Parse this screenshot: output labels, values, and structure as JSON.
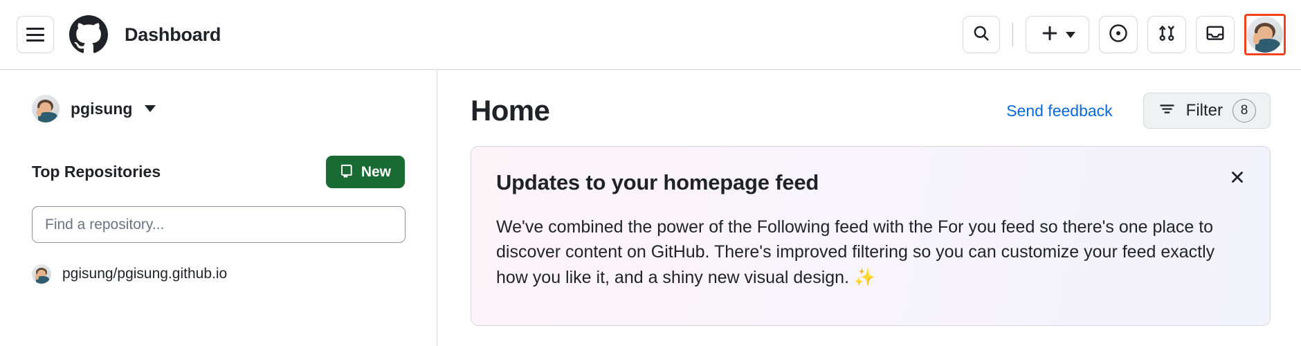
{
  "header": {
    "title": "Dashboard",
    "menu_icon": "hamburger-menu-icon",
    "logo_icon": "github-logo-icon",
    "actions": [
      {
        "name": "search-button",
        "icon": "search-icon"
      },
      {
        "name": "create-new-button",
        "icon": "plus-icon"
      },
      {
        "name": "issues-button",
        "icon": "issue-opened-icon"
      },
      {
        "name": "pull-requests-button",
        "icon": "git-pull-request-icon"
      },
      {
        "name": "notifications-button",
        "icon": "inbox-icon"
      },
      {
        "name": "account-avatar-button",
        "icon": "avatar-icon"
      }
    ],
    "avatar_highlight_color": "#f4421c"
  },
  "sidebar": {
    "account": {
      "username": "pgisung",
      "caret_icon": "chevron-down-icon",
      "avatar_icon": "avatar-icon"
    },
    "repositories": {
      "heading": "Top Repositories",
      "new_button": {
        "label": "New",
        "icon": "repo-icon",
        "color": "#1a6b33"
      },
      "search_placeholder": "Find a repository...",
      "search_value": "",
      "items": [
        {
          "name": "pgisung/pgisung.github.io",
          "avatar_icon": "avatar-icon"
        }
      ]
    }
  },
  "main": {
    "page_title": "Home",
    "send_feedback_label": "Send feedback",
    "send_feedback_color": "#0969da",
    "filter": {
      "label": "Filter",
      "count": "8",
      "icon": "filter-icon"
    },
    "feed_card": {
      "title": "Updates to your homepage feed",
      "body": "We've combined the power of the Following feed with the For you feed so there's one place to discover content on GitHub. There's improved filtering so you can customize your feed exactly how you like it, and a shiny new visual design. ✨",
      "close_icon": "close-icon"
    }
  }
}
